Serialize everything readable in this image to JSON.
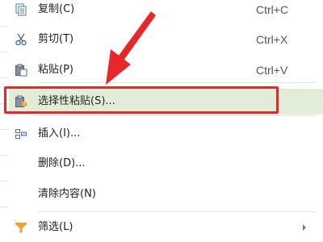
{
  "menu": {
    "items": [
      {
        "label": "复制(C)",
        "shortcut": "Ctrl+C",
        "icon": "copy-icon"
      },
      {
        "label": "剪切(T)",
        "shortcut": "Ctrl+X",
        "icon": "cut-icon"
      },
      {
        "label": "粘贴(P)",
        "shortcut": "Ctrl+V",
        "icon": "paste-icon"
      },
      {
        "label": "选择性粘贴(S)...",
        "shortcut": "",
        "icon": "paste-special-icon"
      },
      {
        "label": "插入(I)...",
        "shortcut": "",
        "icon": "insert-icon"
      },
      {
        "label": "删除(D)...",
        "shortcut": "",
        "icon": ""
      },
      {
        "label": "清除内容(N)",
        "shortcut": "",
        "icon": ""
      },
      {
        "label": "筛选(L)",
        "shortcut": "",
        "icon": "filter-icon"
      }
    ]
  },
  "colors": {
    "selected_bg": "#e2ecd9",
    "annotation_red": "#e8272a"
  }
}
